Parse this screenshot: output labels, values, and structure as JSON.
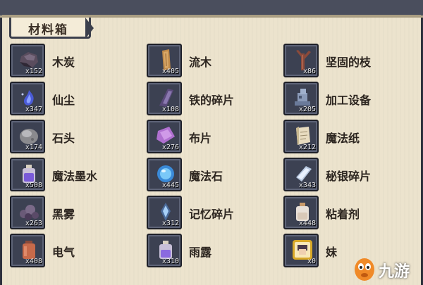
{
  "panel": {
    "title": "材料箱"
  },
  "colors": {
    "panel_bg": "#ece3cd",
    "slot_bg": "#3c4152",
    "text": "#2d2620"
  },
  "items": [
    {
      "name": "木炭",
      "count": "x152",
      "icon": "charcoal-icon"
    },
    {
      "name": "流木",
      "count": "x405",
      "icon": "driftwood-icon"
    },
    {
      "name": "坚固的枝",
      "count": "x86",
      "icon": "sturdy-branch-icon"
    },
    {
      "name": "仙尘",
      "count": "x347",
      "icon": "fairy-dust-icon"
    },
    {
      "name": "铁的碎片",
      "count": "x108",
      "icon": "iron-fragment-icon"
    },
    {
      "name": "加工设备",
      "count": "x205",
      "icon": "processing-device-icon"
    },
    {
      "name": "石头",
      "count": "x174",
      "icon": "stone-icon"
    },
    {
      "name": "布片",
      "count": "x276",
      "icon": "cloth-piece-icon"
    },
    {
      "name": "魔法纸",
      "count": "x212",
      "icon": "magic-paper-icon"
    },
    {
      "name": "魔法墨水",
      "count": "x508",
      "icon": "magic-ink-icon"
    },
    {
      "name": "魔法石",
      "count": "x445",
      "icon": "magic-stone-icon"
    },
    {
      "name": "秘银碎片",
      "count": "x343",
      "icon": "mithril-fragment-icon"
    },
    {
      "name": "黑雾",
      "count": "x263",
      "icon": "black-mist-icon"
    },
    {
      "name": "记忆碎片",
      "count": "x312",
      "icon": "memory-fragment-icon"
    },
    {
      "name": "粘着剂",
      "count": "x448",
      "icon": "adhesive-icon"
    },
    {
      "name": "电气",
      "count": "x408",
      "icon": "electricity-icon"
    },
    {
      "name": "雨露",
      "count": "x310",
      "icon": "rain-dew-icon"
    },
    {
      "name": "妹",
      "count": "x0",
      "icon": "portrait-icon"
    }
  ],
  "watermark": {
    "text": "九游",
    "icon": "nine-game-logo-icon"
  }
}
